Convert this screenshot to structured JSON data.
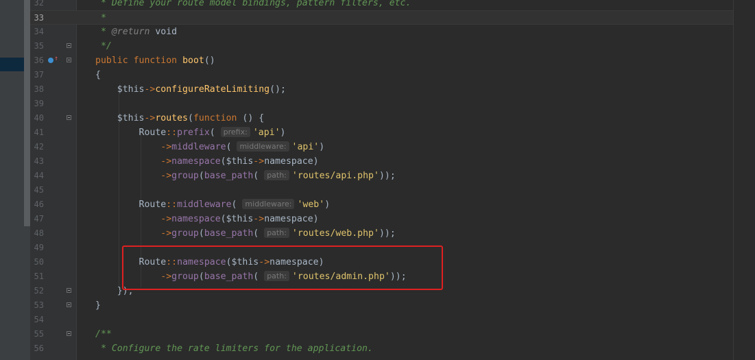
{
  "editor": {
    "current_line": "33",
    "lines": [
      {
        "num": "32",
        "text": " * Define your route model bindings, pattern filters, etc."
      },
      {
        "num": "33",
        "text": " *"
      },
      {
        "num": "34",
        "text": " * @return void"
      },
      {
        "num": "35",
        "text": " */"
      },
      {
        "num": "36",
        "text": "public function boot()"
      },
      {
        "num": "37",
        "text": "{"
      },
      {
        "num": "38",
        "text": "    $this->configureRateLimiting();"
      },
      {
        "num": "39",
        "text": ""
      },
      {
        "num": "40",
        "text": "    $this->routes(function () {"
      },
      {
        "num": "41",
        "text": "        Route::prefix( prefix: 'api')"
      },
      {
        "num": "42",
        "text": "            ->middleware( middleware: 'api')"
      },
      {
        "num": "43",
        "text": "            ->namespace($this->namespace)"
      },
      {
        "num": "44",
        "text": "            ->group(base_path( path: 'routes/api.php'));"
      },
      {
        "num": "45",
        "text": ""
      },
      {
        "num": "46",
        "text": "        Route::middleware( middleware: 'web')"
      },
      {
        "num": "47",
        "text": "            ->namespace($this->namespace)"
      },
      {
        "num": "48",
        "text": "            ->group(base_path( path: 'routes/web.php'));"
      },
      {
        "num": "49",
        "text": ""
      },
      {
        "num": "50",
        "text": "        Route::namespace($this->namespace)"
      },
      {
        "num": "51",
        "text": "            ->group(base_path( path: 'routes/admin.php'));"
      },
      {
        "num": "52",
        "text": "    });"
      },
      {
        "num": "53",
        "text": "}"
      },
      {
        "num": "54",
        "text": ""
      },
      {
        "num": "55",
        "text": "/**"
      },
      {
        "num": "56",
        "text": " * Configure the rate limiters for the application."
      }
    ],
    "tokens": {
      "l32": " * Define your route model bindings, pattern filters, etc.",
      "l33": " *",
      "l34_a": " * ",
      "l34_tag": "@return",
      "l34_b": " void",
      "l35": " */",
      "l36_public": "public",
      "l36_function": "function",
      "l36_name": "boot",
      "l36_rest": "()",
      "l37": "{",
      "this": "$this",
      "arrow": "->",
      "dcolon": "::",
      "l38_method": "configureRateLimiting",
      "l38_rest": "();",
      "l40_routes": "routes",
      "l40_open": "(",
      "l40_function": "function",
      "l40_rest": " () {",
      "route": "Route",
      "prefix": "prefix",
      "middleware": "middleware",
      "namespace_m": "namespace",
      "group": "group",
      "base_path": "base_path",
      "hint_prefix": "prefix:",
      "hint_middleware": "middleware:",
      "hint_path": "path:",
      "str_api": "'api'",
      "str_web": "'web'",
      "str_api_php": "'routes/api.php'",
      "str_web_php": "'routes/web.php'",
      "str_admin_php": "'routes/admin.php'",
      "namespace_prop": "namespace",
      "l52": "});",
      "l53": "}",
      "l55": "/**",
      "l56": " * Configure the rate limiters for the application."
    }
  },
  "colors": {
    "background": "#2b2b2b",
    "gutter": "#313335",
    "keyword": "#cc7832",
    "method": "#ffc66d",
    "field": "#9876aa",
    "string": "#6a8759",
    "comment": "#629755",
    "highlight_box": "#e02020"
  },
  "icons": {
    "line36": "override-method-icon"
  }
}
